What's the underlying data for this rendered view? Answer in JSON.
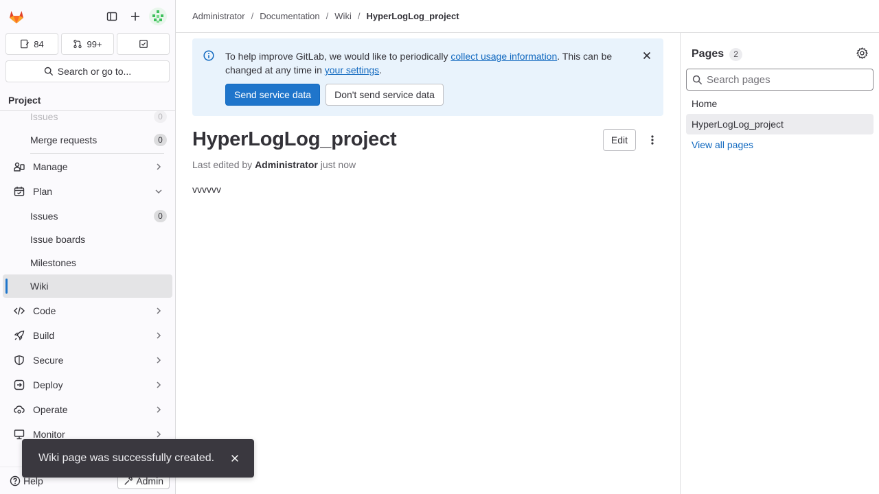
{
  "colors": {
    "brand": "#e24329",
    "accent": "#1f75cb",
    "link": "#1068bf"
  },
  "sidebar": {
    "counts": {
      "issues": "84",
      "merge_requests": "99+"
    },
    "search_label": "Search or go to...",
    "section_title": "Project",
    "items": {
      "issues_faded": {
        "label": "Issues",
        "count": "0"
      },
      "merge_requests": {
        "label": "Merge requests",
        "count": "0"
      },
      "manage": {
        "label": "Manage"
      },
      "plan": {
        "label": "Plan"
      },
      "plan_issues": {
        "label": "Issues",
        "count": "0"
      },
      "issue_boards": {
        "label": "Issue boards"
      },
      "milestones": {
        "label": "Milestones"
      },
      "wiki": {
        "label": "Wiki"
      },
      "code": {
        "label": "Code"
      },
      "build": {
        "label": "Build"
      },
      "secure": {
        "label": "Secure"
      },
      "deploy": {
        "label": "Deploy"
      },
      "operate": {
        "label": "Operate"
      },
      "monitor": {
        "label": "Monitor"
      }
    },
    "help_label": "Help",
    "admin_label": "Admin"
  },
  "breadcrumb": [
    "Administrator",
    "Documentation",
    "Wiki",
    "HyperLogLog_project"
  ],
  "alert": {
    "text_before": "To help improve GitLab, we would like to periodically ",
    "link1": "collect usage information",
    "text_middle": ". This can be changed at any time in ",
    "link2": "your settings",
    "text_after": ".",
    "primary_button": "Send service data",
    "secondary_button": "Don't send service data"
  },
  "page": {
    "title": "HyperLogLog_project",
    "edit_label": "Edit",
    "meta_prefix": "Last edited by",
    "meta_author": "Administrator",
    "meta_time": "just now",
    "content": "vvvvvv"
  },
  "pages_panel": {
    "title": "Pages",
    "count": "2",
    "search_placeholder": "Search pages",
    "items": [
      "Home",
      "HyperLogLog_project"
    ],
    "view_all": "View all pages"
  },
  "toast": {
    "message": "Wiki page was successfully created."
  }
}
